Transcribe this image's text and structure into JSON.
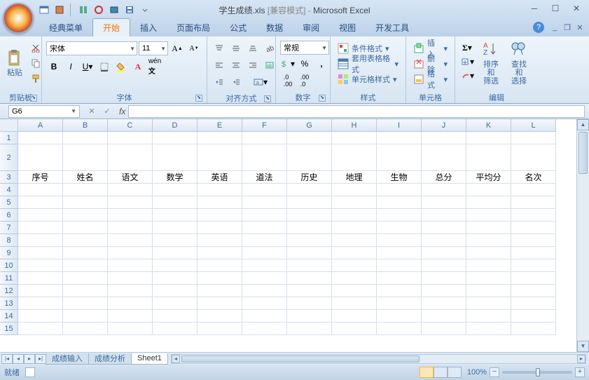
{
  "title": {
    "doc": "学生成绩.xls",
    "mode": "[兼容模式]",
    "app": "Microsoft Excel"
  },
  "tabs": [
    "经典菜单",
    "开始",
    "插入",
    "页面布局",
    "公式",
    "数据",
    "审阅",
    "视图",
    "开发工具"
  ],
  "tabs_active": 1,
  "ribbon": {
    "clipboard": {
      "paste": "粘贴",
      "label": "剪贴板"
    },
    "font": {
      "name": "宋体",
      "size": "11",
      "label": "字体"
    },
    "align": {
      "label": "对齐方式"
    },
    "number": {
      "format": "常规",
      "label": "数字"
    },
    "styles": {
      "cond": "条件格式",
      "table": "套用表格格式",
      "cell": "单元格样式",
      "label": "样式"
    },
    "cells": {
      "insert": "插入",
      "delete": "删除",
      "format": "格式",
      "label": "单元格"
    },
    "editing": {
      "sort": "排序和\n筛选",
      "find": "查找和\n选择",
      "label": "编辑"
    }
  },
  "namebox": "G6",
  "columns": [
    "A",
    "B",
    "C",
    "D",
    "E",
    "F",
    "G",
    "H",
    "I",
    "J",
    "K",
    "L"
  ],
  "rows": [
    "1",
    "2",
    "3",
    "4",
    "5",
    "6",
    "7",
    "8",
    "9",
    "10",
    "11",
    "12",
    "13",
    "14",
    "15"
  ],
  "row2_tall": true,
  "data_row3": [
    "序号",
    "姓名",
    "语文",
    "数学",
    "英语",
    "道法",
    "历史",
    "地理",
    "生物",
    "总分",
    "平均分",
    "名次"
  ],
  "sheets": [
    "成绩输入",
    "成绩分析",
    "Sheet1"
  ],
  "active_sheet": 2,
  "status": "就绪",
  "zoom": "100%"
}
